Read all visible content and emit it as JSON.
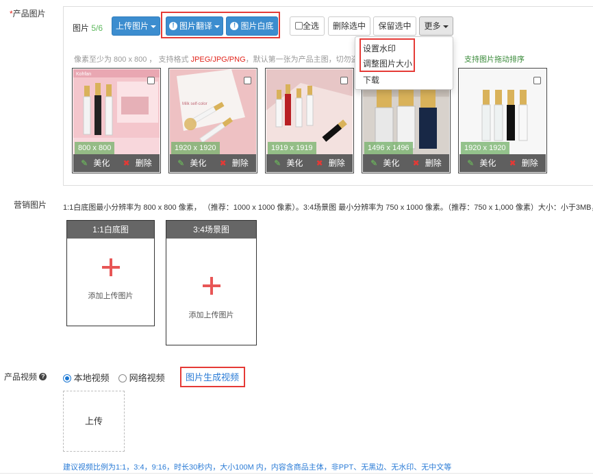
{
  "product_images": {
    "label_required": "*",
    "label": "产品图片",
    "title_prefix": "图片",
    "count": "5/6",
    "buttons": {
      "upload": "上传图片",
      "translate": "图片翻译",
      "white_bg": "图片白底",
      "select_all": "全选",
      "delete_selected": "删除选中",
      "keep_selected": "保留选中",
      "more": "更多"
    },
    "hint_prefix": "像素至少为 800 x 800 ， 支持格式",
    "hint_formats": "JPEG/JPG/PNG",
    "hint_suffix": "，默认第一张为产品主图，切勿盗用",
    "drag_hint": "支持图片拖动排序",
    "more_menu": [
      "设置水印",
      "调整图片大小",
      "下载"
    ],
    "thumbs": [
      {
        "size": "800 x 800",
        "beautify": "美化",
        "delete": "删除"
      },
      {
        "size": "1920 x 1920",
        "beautify": "美化",
        "delete": "删除"
      },
      {
        "size": "1919 x 1919",
        "beautify": "美化",
        "delete": "删除"
      },
      {
        "size": "1496 x 1496",
        "beautify": "美化",
        "delete": "删除"
      },
      {
        "size": "1920 x 1920",
        "beautify": "美化",
        "delete": "删除"
      }
    ],
    "thumb1_brand": "Kohfan",
    "thumb2_caption": "Milk self-color"
  },
  "marketing": {
    "label": "营销图片",
    "hint": "1:1白底图最小分辨率为 800 x 800 像素， （推荐：1000 x 1000 像素）。3:4场景图 最小分辨率为 750 x 1000 像素。（推荐：750 x 1,000 像素）大小：小于3MB，",
    "box1_title": "1:1白底图",
    "box1_text": "添加上传图片",
    "box2_title": "3:4场景图",
    "box2_text": "添加上传图片"
  },
  "video": {
    "label": "产品视频",
    "help_icon": "?",
    "option_local": "本地视频",
    "option_network": "网络视频",
    "generate_link": "图片生成视频",
    "upload": "上传",
    "hint": "建议视频比例为1:1，3:4，9:16，时长30秒内，大小100M 内，内容含商品主体，非PPT、无黑边、无水印、无中文等"
  },
  "colors": {
    "primary_blue": "#3c8dcf",
    "highlight_red": "#e53935",
    "count_green": "#5cb85c",
    "link_blue": "#2a7bd6"
  }
}
